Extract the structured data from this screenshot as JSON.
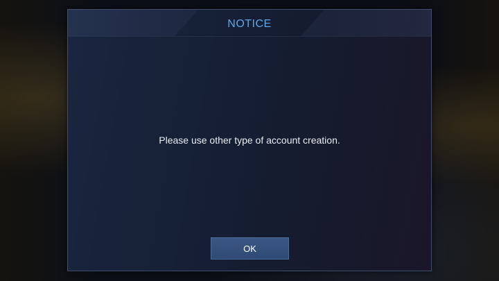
{
  "dialog": {
    "title": "NOTICE",
    "message": "Please use other type of account creation.",
    "ok_label": "OK"
  },
  "colors": {
    "title": "#5ea8e6",
    "button": "#34507c",
    "panel": "#171f35"
  }
}
